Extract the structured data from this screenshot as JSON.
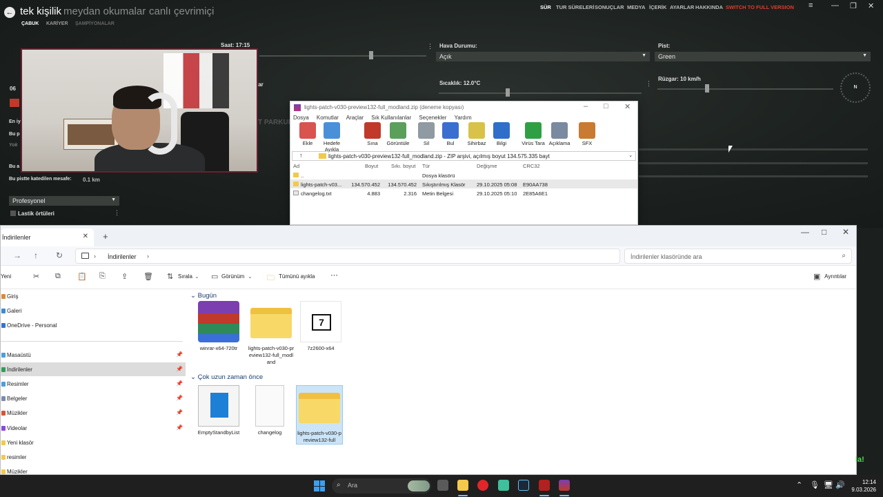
{
  "game": {
    "mode_active": "tek kişilik",
    "modes": [
      "meydan okumalar",
      "canlı",
      "çevrimiçi"
    ],
    "subtabs": [
      "ÇABUK",
      "KARİYER",
      "ŞAMPİYONALAR"
    ],
    "top_nav": [
      "SÜR",
      "TUR SÜRELERİ",
      "SONUÇLAR",
      "MEDYA",
      "İÇERİK",
      "AYARLAR",
      "HAKKINDA"
    ],
    "switch_label": "SWITCH TO FULL VERSION",
    "time_label": "Saat: 17:15",
    "weather_label": "Hava Durumu:",
    "weather_value": "Açık",
    "track_label": "Pist:",
    "track_value": "Green",
    "temp_label": "Sıcaklık: 12.0°C",
    "wind_label": "Rüzgar: 10 km/h",
    "compass": "N",
    "lap_label": "Bu pistte katedilen mesafe:",
    "lap_value": "0.1 km",
    "difficulty_value": "Profesyonel",
    "tyre_label": "Lastik örtüleri",
    "side_labels": [
      "06",
      "En iy",
      "Bu p",
      "Yok",
      "Bu a"
    ],
    "parkur": "T PARKUR",
    "lar": "lar",
    "corner_text": "la!",
    "accent": "#e03a2e"
  },
  "winrar": {
    "title": "lights-patch-v030-preview132-full_modland.zip (deneme kopyası)",
    "menu": [
      "Dosya",
      "Komutlar",
      "Araçlar",
      "Sık Kullanılanlar",
      "Seçenekler",
      "Yardım"
    ],
    "tools": [
      {
        "label": "Ekle",
        "color": "#d9534f"
      },
      {
        "label": "Hedefe Ayıkla",
        "color": "#4a90d9"
      },
      {
        "label": "Sına",
        "color": "#c0392b"
      },
      {
        "label": "Görüntüle",
        "color": "#5aa05a"
      },
      {
        "label": "Sil",
        "color": "#8f9aa3"
      },
      {
        "label": "Bul",
        "color": "#3b6fcf"
      },
      {
        "label": "Sihirbaz",
        "color": "#d8c24a"
      },
      {
        "label": "Bilgi",
        "color": "#2f6fc9"
      },
      {
        "label": "Virüs Tara",
        "color": "#2ea043"
      },
      {
        "label": "Açıklama",
        "color": "#7a8aa0"
      },
      {
        "label": "SFX",
        "color": "#c97b32"
      }
    ],
    "address": "lights-patch-v030-preview132-full_modland.zip - ZIP arşivi, açılmış boyut 134.575.335 bayt",
    "columns": [
      "Ad",
      "Boyut",
      "Sıkı. boyut",
      "Tür",
      "Değişme",
      "CRC32"
    ],
    "rows": [
      {
        "name": "..",
        "size": "",
        "packed": "",
        "type": "Dosya klasörü",
        "modified": "",
        "crc": ""
      },
      {
        "name": "lights-patch-v03...",
        "size": "134.570.452",
        "packed": "134.570.452",
        "type": "Sıkıştırılmış Klasör",
        "modified": "29.10.2025 05:08",
        "crc": "E90AA738"
      },
      {
        "name": "changelog.txt",
        "size": "4.883",
        "packed": "2.316",
        "type": "Metin Belgesi",
        "modified": "29.10.2025 05:10",
        "crc": "2E85A6E1"
      }
    ]
  },
  "explorer": {
    "tab_title": "İndirilenler",
    "breadcrumb": "İndirilenler",
    "search_placeholder": "İndirilenler klasöründe ara",
    "commands": {
      "new": "Yeni",
      "sort": "Sırala",
      "view": "Görünüm",
      "extract_all": "Tümünü ayıkla",
      "details": "Ayrıntılar"
    },
    "sidebar": [
      {
        "label": "Giriş",
        "color": "#d98a3a",
        "pinned": false
      },
      {
        "label": "Galeri",
        "color": "#3a8ad9",
        "pinned": false
      },
      {
        "label": "OneDrive - Personal",
        "color": "#3a6fd9",
        "pinned": false
      },
      {
        "label": "Masaüstü",
        "color": "#4aa0e0",
        "pinned": true
      },
      {
        "label": "İndirilenler",
        "color": "#2e9f5a",
        "pinned": true
      },
      {
        "label": "Resimler",
        "color": "#4aa0e0",
        "pinned": true
      },
      {
        "label": "Belgeler",
        "color": "#7a8ab0",
        "pinned": true
      },
      {
        "label": "Müzikler",
        "color": "#d9543a",
        "pinned": true
      },
      {
        "label": "Videolar",
        "color": "#8a4ad9",
        "pinned": true
      },
      {
        "label": "Yeni klasör",
        "color": "#f2c94c",
        "pinned": false
      },
      {
        "label": "resimler",
        "color": "#f2c94c",
        "pinned": false
      },
      {
        "label": "Müzikler",
        "color": "#f2c94c",
        "pinned": false
      }
    ],
    "groups": [
      {
        "name": "Bugün",
        "items": [
          {
            "label": "winrar-x64-720tr",
            "icon": "winrar-installer-icon"
          },
          {
            "label": "lights-patch-v030-preview132-full_modland",
            "icon": "zip-folder-icon"
          },
          {
            "label": "7z2600-x64",
            "icon": "7zip-icon"
          }
        ]
      },
      {
        "name": "Çok uzun zaman önce",
        "items": [
          {
            "label": "EmptyStandbyList",
            "icon": "app-icon"
          },
          {
            "label": "changelog",
            "icon": "text-file-icon"
          },
          {
            "label": "lights-patch-v030-preview132-full",
            "icon": "zip-folder-icon"
          }
        ]
      }
    ]
  },
  "taskbar": {
    "search_placeholder": "Ara",
    "time": "12:14",
    "date": "9.03.2026"
  }
}
